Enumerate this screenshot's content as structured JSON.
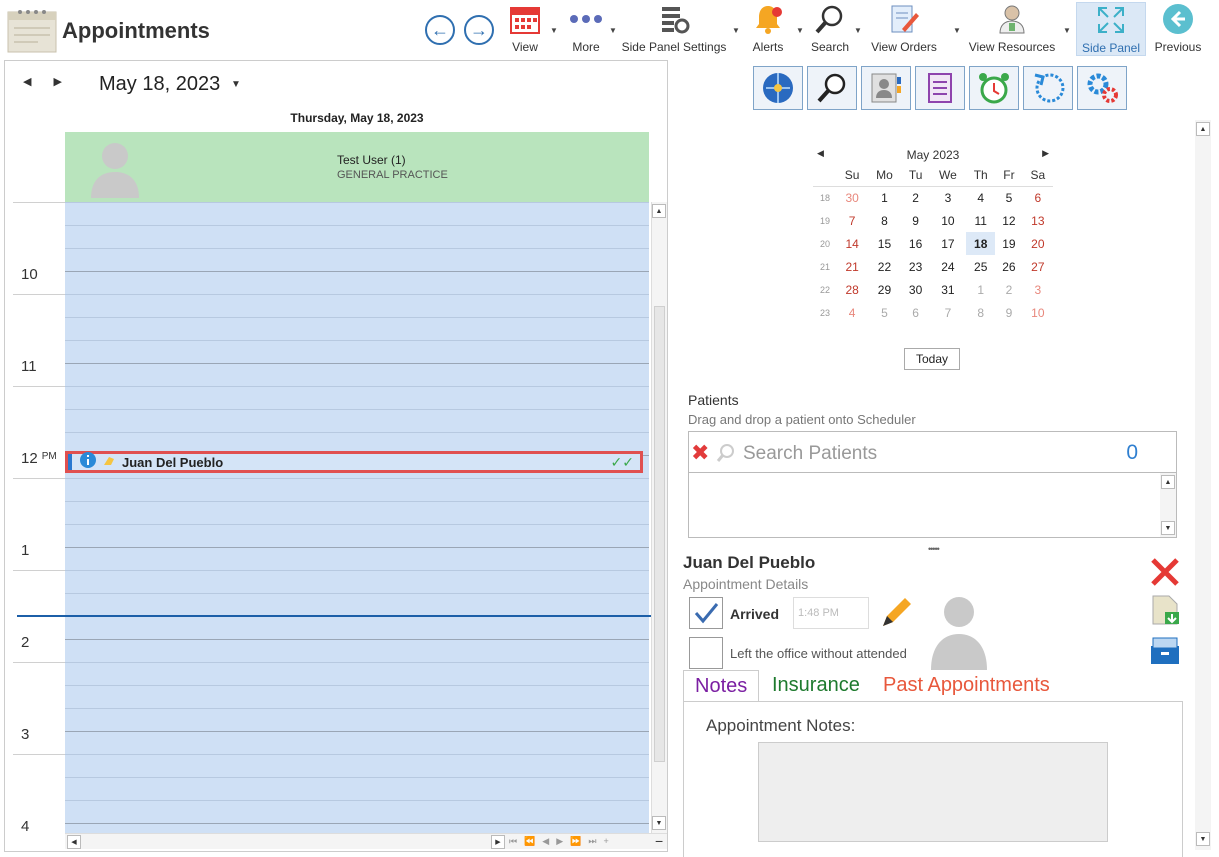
{
  "app": {
    "title": "Appointments"
  },
  "toolbar": {
    "items": [
      {
        "label": "View"
      },
      {
        "label": "More"
      },
      {
        "label": "Side Panel Settings"
      },
      {
        "label": "Alerts"
      },
      {
        "label": "Search"
      },
      {
        "label": "View Orders"
      },
      {
        "label": "View Resources"
      },
      {
        "label": "Side Panel"
      },
      {
        "label": "Previous"
      }
    ]
  },
  "scheduler": {
    "date_label": "May 18, 2023",
    "day_header": "Thursday, May 18, 2023",
    "resource": {
      "name": "Test User (1)",
      "specialty": "GENERAL PRACTICE"
    },
    "times": [
      "10",
      "11",
      "12",
      "1",
      "2",
      "3",
      "4"
    ],
    "pm_marker": "PM",
    "appointment": {
      "name": "Juan Del Pueblo",
      "checks": "✓✓"
    }
  },
  "side_panel": {
    "calendar": {
      "title": "May 2023",
      "weekdays": [
        "Su",
        "Mo",
        "Tu",
        "We",
        "Th",
        "Fr",
        "Sa"
      ],
      "weeks": [
        {
          "wk": "18",
          "days": [
            "30",
            "1",
            "2",
            "3",
            "4",
            "5",
            "6"
          ]
        },
        {
          "wk": "19",
          "days": [
            "7",
            "8",
            "9",
            "10",
            "11",
            "12",
            "13"
          ]
        },
        {
          "wk": "20",
          "days": [
            "14",
            "15",
            "16",
            "17",
            "18",
            "19",
            "20"
          ]
        },
        {
          "wk": "21",
          "days": [
            "21",
            "22",
            "23",
            "24",
            "25",
            "26",
            "27"
          ]
        },
        {
          "wk": "22",
          "days": [
            "28",
            "29",
            "30",
            "31",
            "1",
            "2",
            "3"
          ]
        },
        {
          "wk": "23",
          "days": [
            "4",
            "5",
            "6",
            "7",
            "8",
            "9",
            "10"
          ]
        }
      ],
      "today_label": "Today"
    },
    "patients": {
      "title": "Patients",
      "subtitle": "Drag and drop a patient onto Scheduler",
      "search_placeholder": "Search Patients",
      "count": "0"
    },
    "details": {
      "name": "Juan Del Pueblo",
      "subtitle": "Appointment Details",
      "arrived_label": "Arrived",
      "arrived_time": "1:48 PM",
      "left_label": "Left the office without attended"
    },
    "tabs": [
      {
        "label": "Notes",
        "color": "#7b1fa2"
      },
      {
        "label": "Insurance",
        "color": "#1e7a2e"
      },
      {
        "label": "Past Appointments",
        "color": "#e8583c"
      }
    ],
    "notes_label": "Appointment Notes:"
  }
}
